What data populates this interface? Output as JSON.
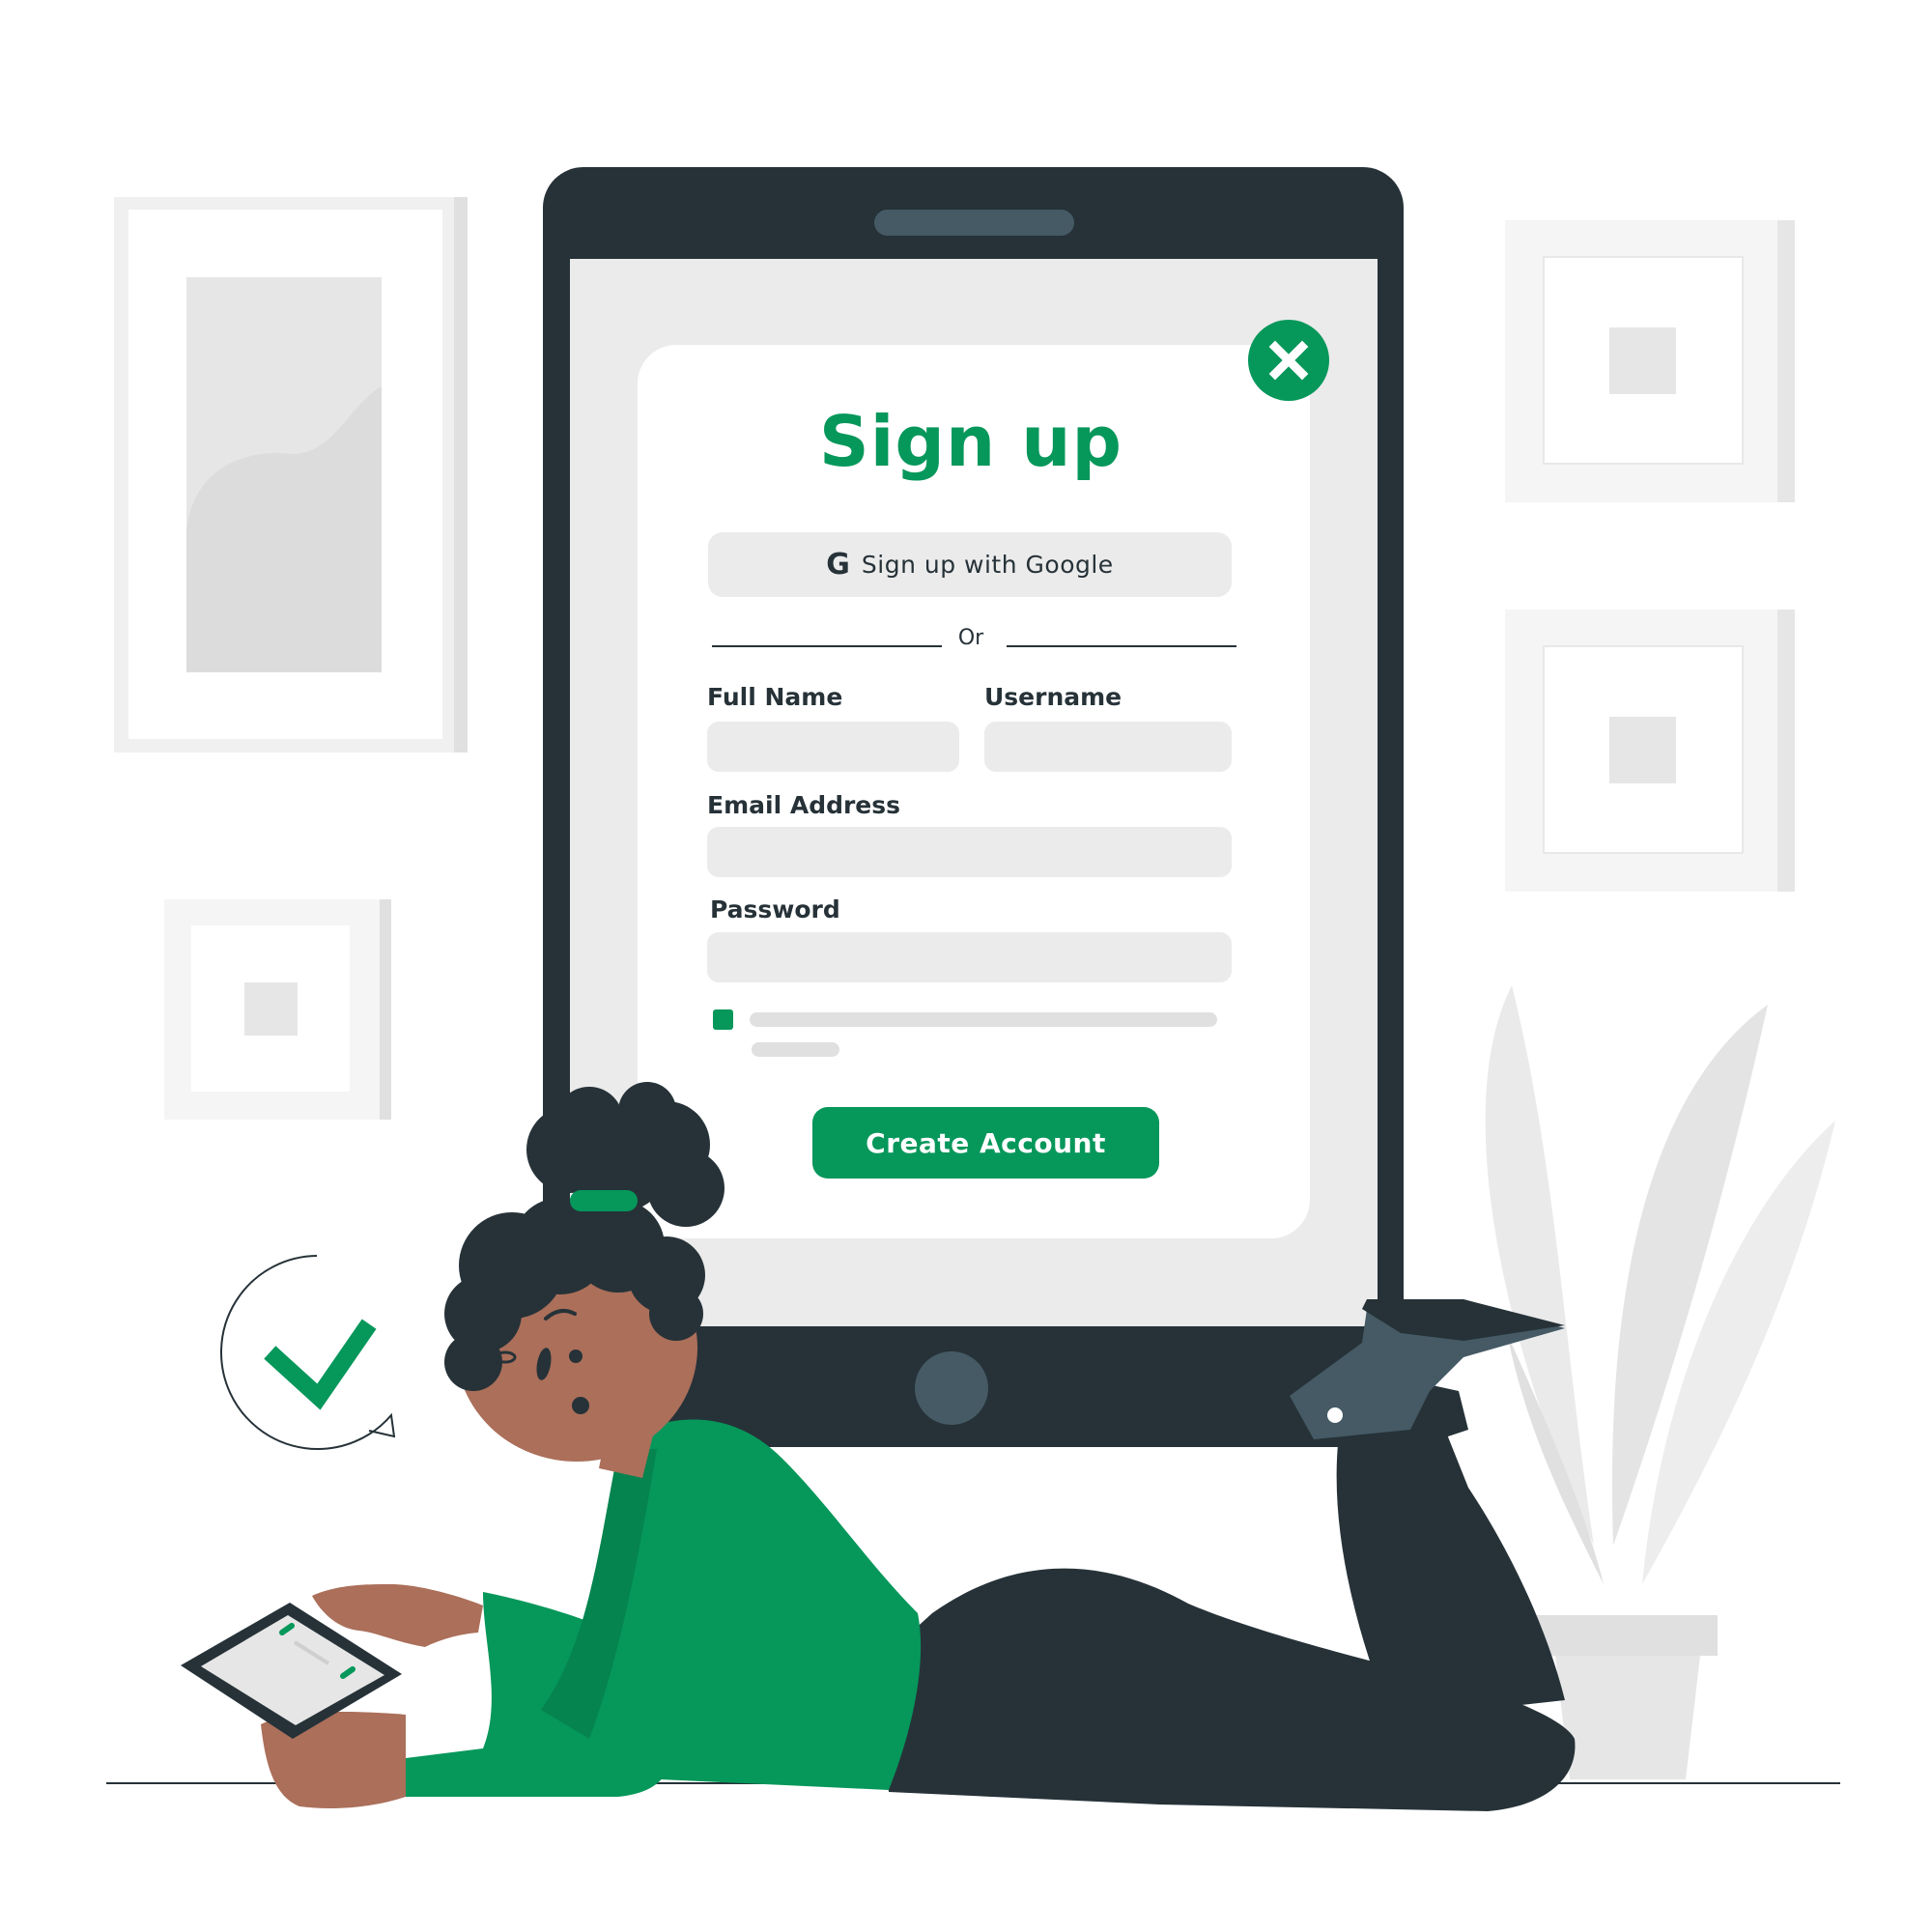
{
  "signup_modal": {
    "title": "Sign up",
    "google_button_label": "Sign up with Google",
    "google_icon_glyph": "G",
    "divider_text": "Or",
    "fields": {
      "full_name_label": "Full Name",
      "username_label": "Username",
      "email_label": "Email Address",
      "password_label": "Password",
      "full_name_value": "",
      "username_value": "",
      "email_value": "",
      "password_value": ""
    },
    "terms_checkbox_checked": true,
    "create_button_label": "Create Account"
  },
  "icons": {
    "close": "close-icon",
    "google": "google-icon",
    "check": "checkmark-icon"
  },
  "colors": {
    "accent": "#06975B",
    "dark": "#263238",
    "light_gray": "#EBEBEB",
    "skin": "#AB6F5A"
  }
}
